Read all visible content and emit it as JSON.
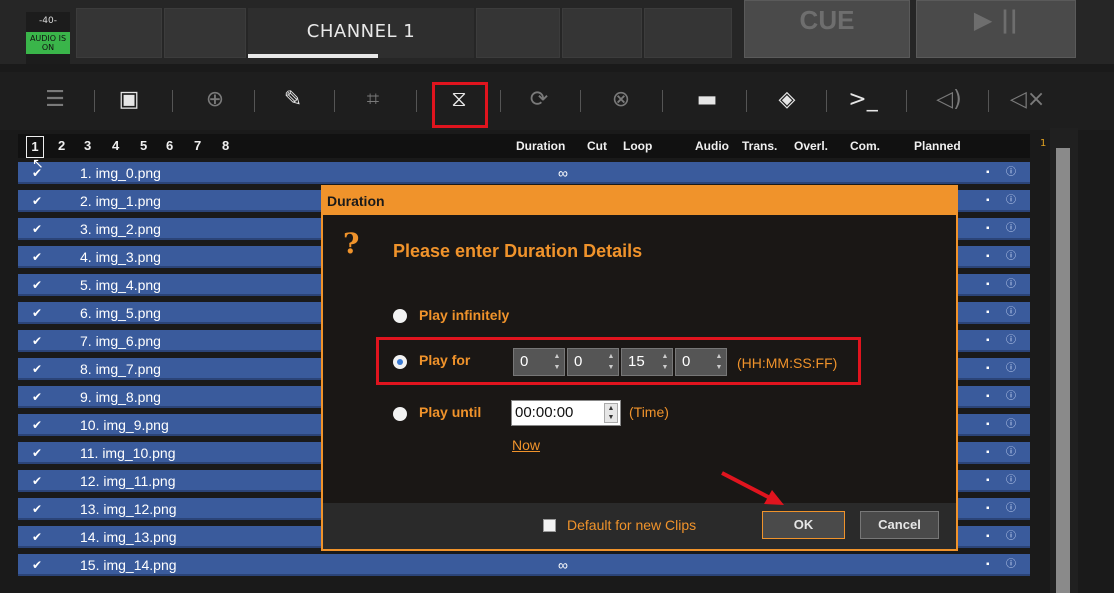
{
  "header": {
    "meter_value": "-40-",
    "audio_badge": "AUDIO IS ON",
    "channel_title": "CHANNEL 1",
    "cue_label": "CUE",
    "play_label": "▶ ||"
  },
  "toolbar": {
    "icons": [
      "list-icon",
      "timeline-icon",
      "preview-icon",
      "magic-wand-icon",
      "crop-icon",
      "duration-icon",
      "loop-icon",
      "loop-off-icon",
      "transition-icon",
      "layers-icon",
      "command-icon",
      "audio-icon",
      "mute-icon"
    ]
  },
  "tabs": [
    "1",
    "2",
    "3",
    "4",
    "5",
    "6",
    "7",
    "8"
  ],
  "columns": {
    "duration": "Duration",
    "cut": "Cut",
    "loop": "Loop",
    "audio": "Audio",
    "trans": "Trans.",
    "overl": "Overl.",
    "com": "Com.",
    "planned": "Planned"
  },
  "page_indicator": "1",
  "rows": [
    {
      "check": "✔",
      "name": "1. img_0.png",
      "duration": "∞",
      "dot": "▪",
      "info": "ⓘ"
    },
    {
      "check": "✔",
      "name": "2. img_1.png",
      "duration": "",
      "dot": "▪",
      "info": "ⓘ"
    },
    {
      "check": "✔",
      "name": "3. img_2.png",
      "duration": "",
      "dot": "▪",
      "info": "ⓘ"
    },
    {
      "check": "✔",
      "name": "4. img_3.png",
      "duration": "",
      "dot": "▪",
      "info": "ⓘ"
    },
    {
      "check": "✔",
      "name": "5. img_4.png",
      "duration": "",
      "dot": "▪",
      "info": "ⓘ"
    },
    {
      "check": "✔",
      "name": "6. img_5.png",
      "duration": "",
      "dot": "▪",
      "info": "ⓘ"
    },
    {
      "check": "✔",
      "name": "7. img_6.png",
      "duration": "",
      "dot": "▪",
      "info": "ⓘ"
    },
    {
      "check": "✔",
      "name": "8. img_7.png",
      "duration": "",
      "dot": "▪",
      "info": "ⓘ"
    },
    {
      "check": "✔",
      "name": "9. img_8.png",
      "duration": "",
      "dot": "▪",
      "info": "ⓘ"
    },
    {
      "check": "✔",
      "name": "10. img_9.png",
      "duration": "",
      "dot": "▪",
      "info": "ⓘ"
    },
    {
      "check": "✔",
      "name": "11. img_10.png",
      "duration": "",
      "dot": "▪",
      "info": "ⓘ"
    },
    {
      "check": "✔",
      "name": "12. img_11.png",
      "duration": "",
      "dot": "▪",
      "info": "ⓘ"
    },
    {
      "check": "✔",
      "name": "13. img_12.png",
      "duration": "",
      "dot": "▪",
      "info": "ⓘ"
    },
    {
      "check": "✔",
      "name": "14. img_13.png",
      "duration": "∞",
      "dot": "▪",
      "info": "ⓘ"
    },
    {
      "check": "✔",
      "name": "15. img_14.png",
      "duration": "∞",
      "dot": "▪",
      "info": "ⓘ"
    }
  ],
  "dialog": {
    "title": "Duration",
    "question_icon": "?",
    "heading": "Please enter Duration Details",
    "opt_infinite": "Play infinitely",
    "opt_for": "Play for",
    "opt_until": "Play until",
    "hh": "0",
    "mm": "0",
    "ss": "15",
    "ff": "0",
    "format_hint": "(HH:MM:SS:FF)",
    "until_time": "00:00:00",
    "time_hint": "(Time)",
    "now_link": "Now",
    "default_label": "Default for new Clips",
    "ok_label": "OK",
    "cancel_label": "Cancel"
  },
  "colors": {
    "accent": "#f0932b",
    "row_blue": "#3a5b9c",
    "highlight_red": "#e0141e",
    "audio_green": "#3ab54a"
  }
}
